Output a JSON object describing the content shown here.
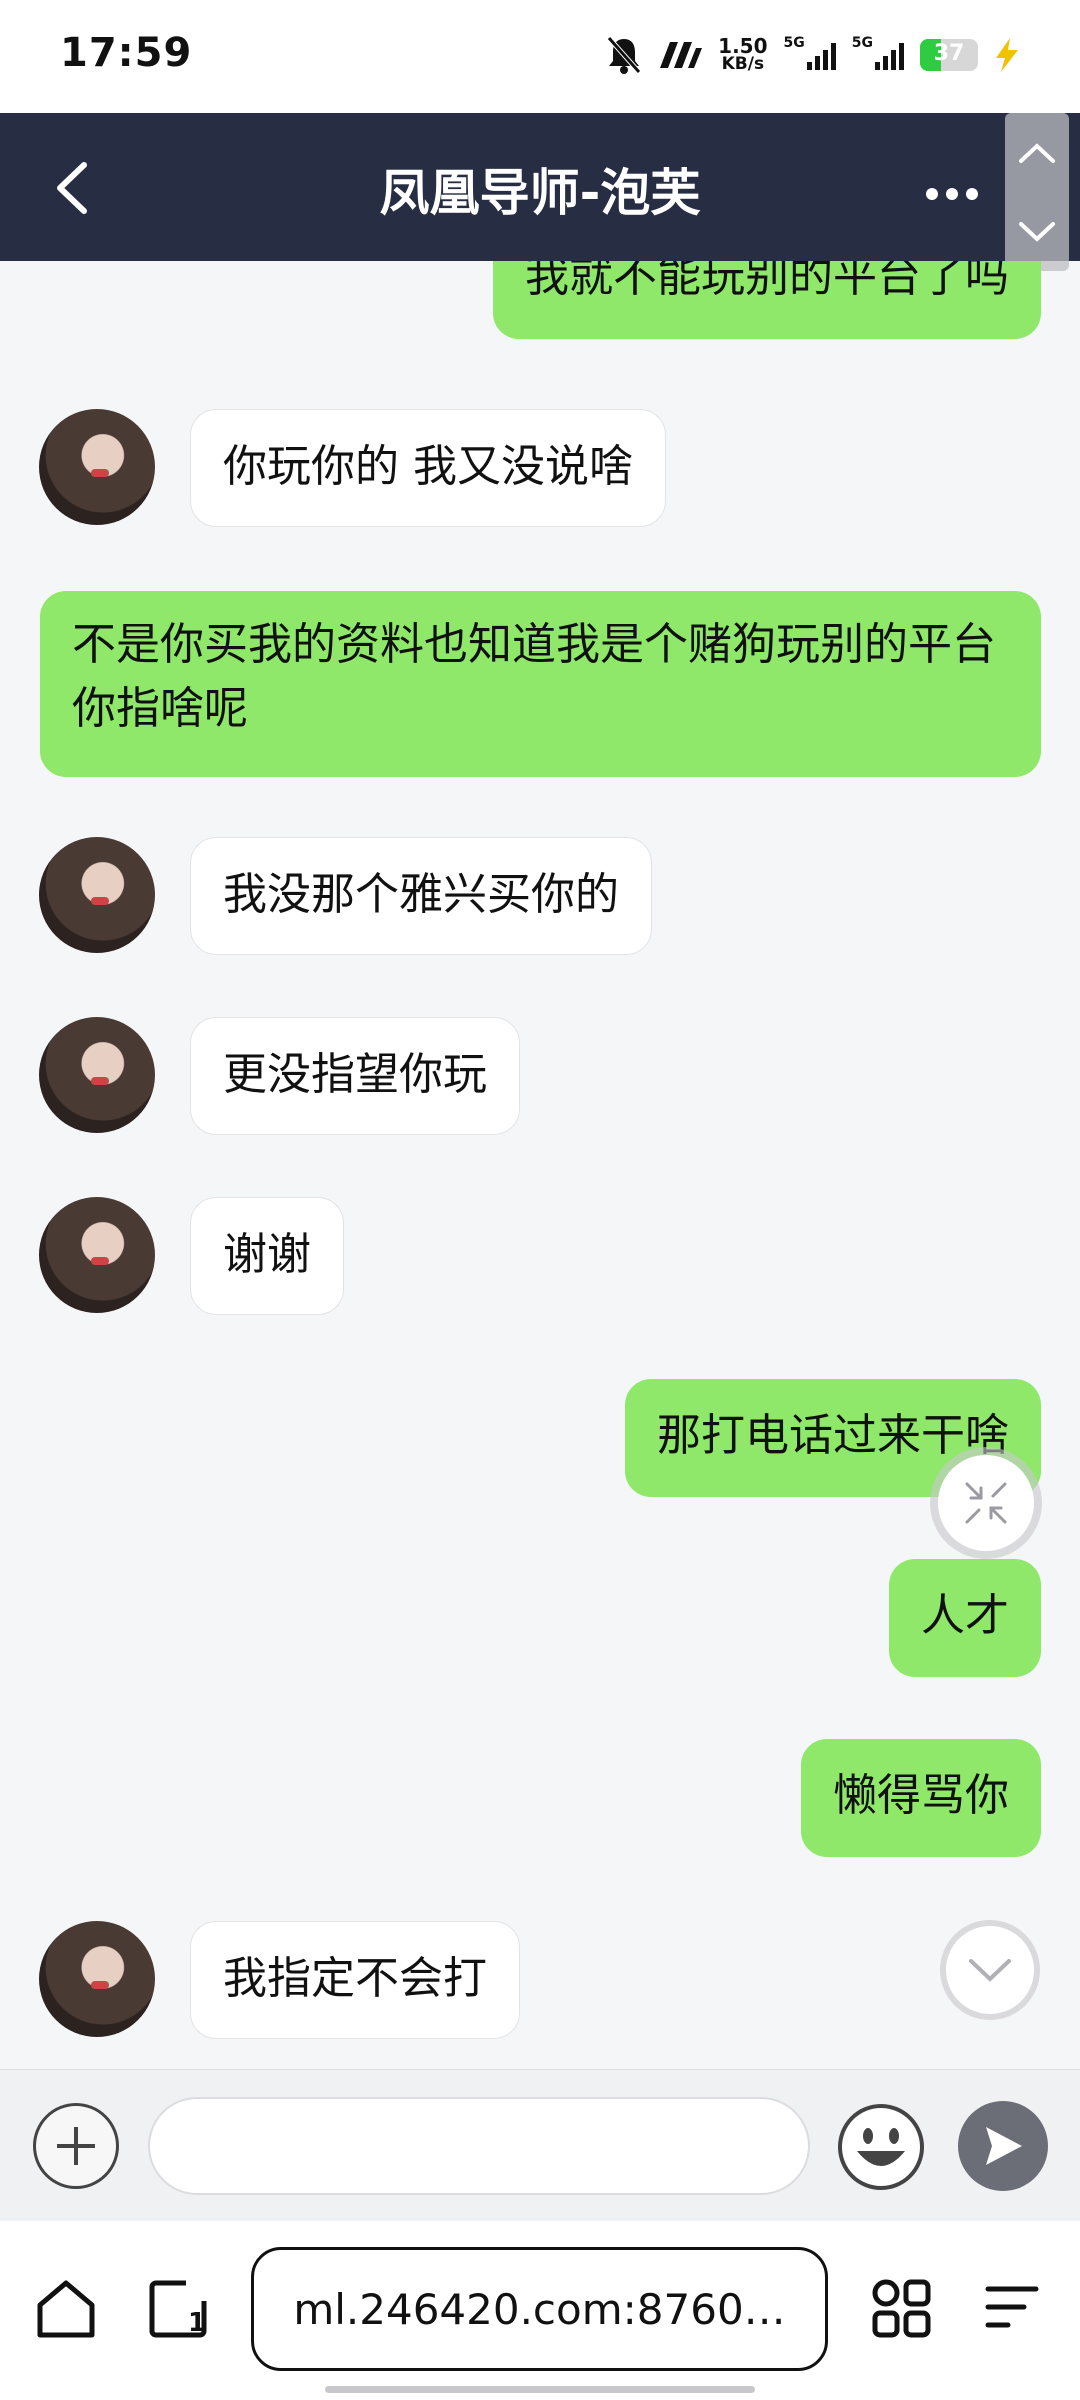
{
  "status_bar": {
    "time": "17:59",
    "net_speed_value": "1.50",
    "net_speed_unit": "KB/s",
    "sim1_label": "5G",
    "sim2_label": "5G",
    "battery_level": "37",
    "icons": [
      "mute-icon",
      "nfc-icon",
      "signal-icon",
      "battery-icon",
      "charging-icon"
    ]
  },
  "header": {
    "title": "凤凰导师-泡芙",
    "back_icon": "chevron-left-icon",
    "more_icon": "more-icon"
  },
  "messages": [
    {
      "side": "right",
      "text": "我就不能玩别的平台了吗"
    },
    {
      "side": "left",
      "text": "你玩你的 我又没说啥"
    },
    {
      "side": "right",
      "text": "不是你买我的资料也知道我是个赌狗玩别的平台你指啥呢"
    },
    {
      "side": "left",
      "text": "我没那个雅兴买你的"
    },
    {
      "side": "left",
      "text": "更没指望你玩"
    },
    {
      "side": "left",
      "text": "谢谢"
    },
    {
      "side": "right",
      "text": "那打电话过来干啥"
    },
    {
      "side": "right",
      "text": "人才"
    },
    {
      "side": "right",
      "text": "懒得骂你"
    },
    {
      "side": "left",
      "text": "我指定不会打"
    }
  ],
  "input_bar": {
    "placeholder": "",
    "value": ""
  },
  "browser_bar": {
    "url": "ml.246420.com:8760…"
  },
  "colors": {
    "header_bg": "#272d42",
    "bubble_right": "#8fe86a",
    "bubble_left": "#ffffff",
    "chat_bg": "#f5f6f8"
  }
}
